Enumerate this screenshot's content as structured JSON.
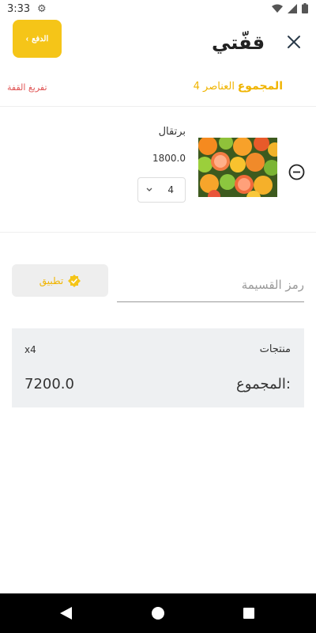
{
  "status_bar": {
    "time": "3:33",
    "icons": [
      "gear-icon",
      "wifi-icon",
      "signal-icon",
      "battery-icon"
    ]
  },
  "header": {
    "brand": "قفّتي",
    "pay_label": "الدفع",
    "close_icon": "close-icon"
  },
  "cart_summary": {
    "total_label": "المجموع",
    "items_count": "4 العناصر",
    "clear_label": "تفريغ القفة"
  },
  "items": [
    {
      "name": "برتقال",
      "price": "1800.0",
      "quantity": "4",
      "image": "oranges-citrus-photo"
    }
  ],
  "coupon": {
    "placeholder": "رمز القسيمة",
    "value": "",
    "apply_label": "تطبيق"
  },
  "order_summary": {
    "products_label": "منتجات",
    "products_count": "x4",
    "sum_label": "المجموع:",
    "sum_value": "7200.0"
  },
  "colors": {
    "accent": "#f5c518",
    "accent_text": "#f0b400",
    "danger": "#e05656",
    "card_bg": "#eef0f2"
  }
}
